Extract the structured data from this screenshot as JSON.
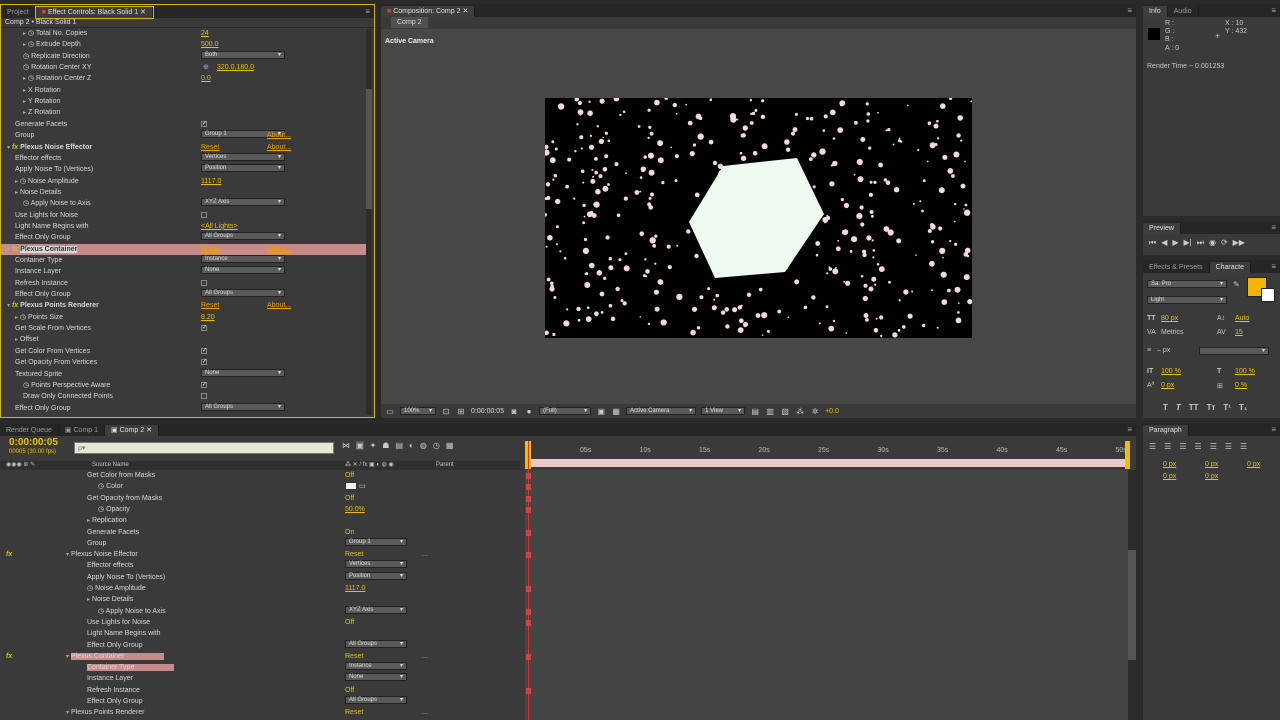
{
  "left_tabs": [
    "Project",
    "Effect Controls: Black Solid 1"
  ],
  "ec_header": "Comp 2 • Black Solid 1",
  "effect_controls": [
    {
      "indent": 2,
      "twirl": "▸",
      "stopwatch": true,
      "label": "Total No. Copies",
      "value": "24",
      "vtype": "num"
    },
    {
      "indent": 2,
      "twirl": "▸",
      "stopwatch": true,
      "label": "Extrude Depth",
      "value": "500.0",
      "vtype": "num"
    },
    {
      "indent": 2,
      "twirl": "",
      "stopwatch": true,
      "label": "Replicate Direction",
      "value": "Both",
      "vtype": "dd"
    },
    {
      "indent": 2,
      "twirl": "",
      "stopwatch": true,
      "label": "Rotation Center XY",
      "value": "320.0,180.0",
      "vtype": "point"
    },
    {
      "indent": 2,
      "twirl": "▸",
      "stopwatch": true,
      "label": "Rotation Center Z",
      "value": "0.0",
      "vtype": "num"
    },
    {
      "indent": 2,
      "twirl": "▸",
      "stopwatch": false,
      "label": "X Rotation",
      "value": "",
      "vtype": ""
    },
    {
      "indent": 2,
      "twirl": "▸",
      "stopwatch": false,
      "label": "Y Rotation",
      "value": "",
      "vtype": ""
    },
    {
      "indent": 2,
      "twirl": "▸",
      "stopwatch": false,
      "label": "Z Rotation",
      "value": "",
      "vtype": ""
    },
    {
      "indent": 1,
      "twirl": "",
      "stopwatch": false,
      "label": "Generate Facets",
      "value": "✓",
      "vtype": "cb"
    },
    {
      "indent": 1,
      "twirl": "",
      "stopwatch": false,
      "label": "Group",
      "value": "Group 1",
      "vtype": "dd",
      "extra": "About..."
    },
    {
      "indent": 0,
      "twirl": "▾",
      "fx": true,
      "stopwatch": false,
      "label": "Plexus Noise Effector",
      "value": "Reset",
      "vtype": "reset",
      "extra": "About..."
    },
    {
      "indent": 1,
      "twirl": "",
      "stopwatch": false,
      "label": "Effector effects",
      "value": "Vertices",
      "vtype": "dd"
    },
    {
      "indent": 1,
      "twirl": "",
      "stopwatch": false,
      "label": "Apply Noise To (Vertices)",
      "value": "Position",
      "vtype": "dd"
    },
    {
      "indent": 1,
      "twirl": "▸",
      "stopwatch": true,
      "label": "Noise Amplitude",
      "value": "1117.0",
      "vtype": "num"
    },
    {
      "indent": 1,
      "twirl": "▸",
      "stopwatch": false,
      "label": "Noise Details",
      "value": "",
      "vtype": ""
    },
    {
      "indent": 2,
      "twirl": "",
      "stopwatch": true,
      "label": "Apply Noise to Axis",
      "value": "XYZ Axis",
      "vtype": "dd"
    },
    {
      "indent": 1,
      "twirl": "",
      "stopwatch": false,
      "label": "Use Lights for Noise",
      "value": "",
      "vtype": "cb"
    },
    {
      "indent": 1,
      "twirl": "",
      "stopwatch": false,
      "label": "Light Name Begins with",
      "value": "<All Lights>",
      "vtype": "num"
    },
    {
      "indent": 1,
      "twirl": "",
      "stopwatch": false,
      "label": "Effect Only Group",
      "value": "All Groups",
      "vtype": "dd"
    },
    {
      "indent": 0,
      "twirl": "▾",
      "fx": true,
      "stopwatch": false,
      "label": "Plexus Container",
      "value": "Reset",
      "vtype": "reset",
      "extra": "About...",
      "selected": true
    },
    {
      "indent": 1,
      "twirl": "",
      "stopwatch": false,
      "label": "Container Type",
      "value": "Instance",
      "vtype": "dd"
    },
    {
      "indent": 1,
      "twirl": "",
      "stopwatch": false,
      "label": "Instance Layer",
      "value": "None",
      "vtype": "dd"
    },
    {
      "indent": 1,
      "twirl": "",
      "stopwatch": false,
      "label": "Refresh Instance",
      "value": "",
      "vtype": "cb"
    },
    {
      "indent": 1,
      "twirl": "",
      "stopwatch": false,
      "label": "Effect Only Group",
      "value": "All Groups",
      "vtype": "dd"
    },
    {
      "indent": 0,
      "twirl": "▾",
      "fx": true,
      "stopwatch": false,
      "label": "Plexus Points Renderer",
      "value": "Reset",
      "vtype": "reset",
      "extra": "About..."
    },
    {
      "indent": 1,
      "twirl": "▸",
      "stopwatch": true,
      "label": "Points Size",
      "value": "8.20",
      "vtype": "num"
    },
    {
      "indent": 1,
      "twirl": "",
      "stopwatch": false,
      "label": "Get Scale From Vertices",
      "value": "✓",
      "vtype": "cb"
    },
    {
      "indent": 1,
      "twirl": "▸",
      "stopwatch": false,
      "label": "Offset",
      "value": "",
      "vtype": ""
    },
    {
      "indent": 1,
      "twirl": "",
      "stopwatch": false,
      "label": "Get Color From Vertices",
      "value": "✓",
      "vtype": "cb"
    },
    {
      "indent": 1,
      "twirl": "",
      "stopwatch": false,
      "label": "Get Opacity From Vertices",
      "value": "✓",
      "vtype": "cb"
    },
    {
      "indent": 1,
      "twirl": "",
      "stopwatch": false,
      "label": "Textured Sprite",
      "value": "None",
      "vtype": "dd"
    },
    {
      "indent": 2,
      "twirl": "",
      "stopwatch": true,
      "label": "Points Perspective Aware",
      "value": "✓",
      "vtype": "cb"
    },
    {
      "indent": 2,
      "twirl": "",
      "stopwatch": false,
      "label": "Draw Only Connected Points",
      "value": "",
      "vtype": "cb"
    },
    {
      "indent": 1,
      "twirl": "",
      "stopwatch": false,
      "label": "Effect Only Group",
      "value": "All Groups",
      "vtype": "dd"
    }
  ],
  "comp_tabs": [
    "Composition: Comp 2"
  ],
  "comp_subtab": "Comp 2",
  "comp_camera_label": "Active Camera",
  "comp_toolbar": {
    "zoom": "100%",
    "timecode": "0:00:00:05",
    "resolution": "(Full)",
    "camera": "Active Camera",
    "views": "1 View",
    "exposure": "+0.0"
  },
  "info": {
    "tabs": [
      "Info",
      "Audio"
    ],
    "r": "R :",
    "g": "G :",
    "b": "B :",
    "a": "A : 0",
    "x": "X : 10",
    "y": "Y : 432",
    "render_time": "Render Time ~ 0.001253"
  },
  "preview_tab": "Preview",
  "char_tabs": [
    "Effects & Presets",
    "Characte"
  ],
  "character": {
    "font": "Sa. Pro",
    "style": "Light",
    "size": "80 px",
    "leading": "Auto",
    "kerning": "Metrics",
    "tracking": "15",
    "stroke": "– px",
    "vscale": "100 %",
    "hscale": "100 %",
    "baseline": "0 px",
    "tsume": "0 %"
  },
  "paragraph": {
    "tab": "Paragraph",
    "values": [
      "0 px",
      "0 px",
      "0 px",
      "0 px",
      "0 px"
    ]
  },
  "timeline_tabs": [
    "Render Queue",
    "Comp 1",
    "Comp 2"
  ],
  "timeline": {
    "timecode": "0:00:00:05",
    "frames": "00005 (30.00 fps)",
    "search_placeholder": "ρ▾",
    "col_source": "Source Name",
    "col_parent": "Parent",
    "ruler": [
      "05s",
      "10s",
      "15s",
      "20s",
      "25s",
      "30s",
      "35s",
      "40s",
      "45s",
      "50s"
    ],
    "rows": [
      {
        "indent": 3,
        "twirl": "",
        "label": "Get Color from Masks",
        "value": "Off",
        "vtype": "off"
      },
      {
        "indent": 4,
        "twirl": "",
        "stopwatch": true,
        "label": "Color",
        "value": "",
        "vtype": "swatch"
      },
      {
        "indent": 3,
        "twirl": "",
        "label": "Get Opacity from Masks",
        "value": "Off",
        "vtype": "off"
      },
      {
        "indent": 4,
        "twirl": "",
        "stopwatch": true,
        "label": "Opacity",
        "value": "50.0%",
        "vtype": "num"
      },
      {
        "indent": 3,
        "twirl": "▸",
        "label": "Replication",
        "value": "",
        "vtype": ""
      },
      {
        "indent": 3,
        "twirl": "",
        "label": "Generate Facets",
        "value": "On",
        "vtype": "off"
      },
      {
        "indent": 3,
        "twirl": "",
        "label": "Group",
        "value": "Group 1",
        "vtype": "dd"
      },
      {
        "indent": 2,
        "twirl": "▾",
        "fx": true,
        "label": "Plexus Noise Effector",
        "value": "Reset",
        "vtype": "reset",
        "extra": "..."
      },
      {
        "indent": 3,
        "twirl": "",
        "label": "Effector effects",
        "value": "Vertices",
        "vtype": "dd"
      },
      {
        "indent": 3,
        "twirl": "",
        "label": "Apply Noise To (Vertices)",
        "value": "Position",
        "vtype": "dd"
      },
      {
        "indent": 3,
        "twirl": "",
        "stopwatch": true,
        "label": "Noise Amplitude",
        "value": "1117.0",
        "vtype": "num"
      },
      {
        "indent": 3,
        "twirl": "▸",
        "label": "Noise Details",
        "value": "",
        "vtype": ""
      },
      {
        "indent": 4,
        "twirl": "",
        "stopwatch": true,
        "label": "Apply Noise to Axis",
        "value": "XYZ Axis",
        "vtype": "dd"
      },
      {
        "indent": 3,
        "twirl": "",
        "label": "Use Lights for Noise",
        "value": "Off",
        "vtype": "off"
      },
      {
        "indent": 3,
        "twirl": "",
        "label": "Light Name Begins with",
        "value": "",
        "vtype": ""
      },
      {
        "indent": 3,
        "twirl": "",
        "label": "Effect Only Group",
        "value": "All Groups",
        "vtype": "dd"
      },
      {
        "indent": 2,
        "twirl": "▾",
        "fx": true,
        "label": "Plexus Container",
        "value": "Reset",
        "vtype": "reset",
        "extra": "...",
        "selected": true
      },
      {
        "indent": 3,
        "twirl": "",
        "label": "Container Type",
        "value": "Instance",
        "vtype": "dd",
        "selected": true
      },
      {
        "indent": 3,
        "twirl": "",
        "label": "Instance Layer",
        "value": "None",
        "vtype": "dd"
      },
      {
        "indent": 3,
        "twirl": "",
        "label": "Refresh Instance",
        "value": "Off",
        "vtype": "off"
      },
      {
        "indent": 3,
        "twirl": "",
        "label": "Effect Only Group",
        "value": "All Groups",
        "vtype": "dd"
      },
      {
        "indent": 2,
        "twirl": "▾",
        "fx": false,
        "label": "Plexus Points Renderer",
        "value": "Reset",
        "vtype": "reset",
        "extra": "..."
      }
    ]
  },
  "colors": {
    "accent": "#e8c200",
    "selection": "#c78b8b",
    "playhead": "#e03030",
    "work_area": "#e8c8c8",
    "viewer_bg": "#000000",
    "hexagon": "#eefaf0",
    "particles": "#f3d9df"
  }
}
